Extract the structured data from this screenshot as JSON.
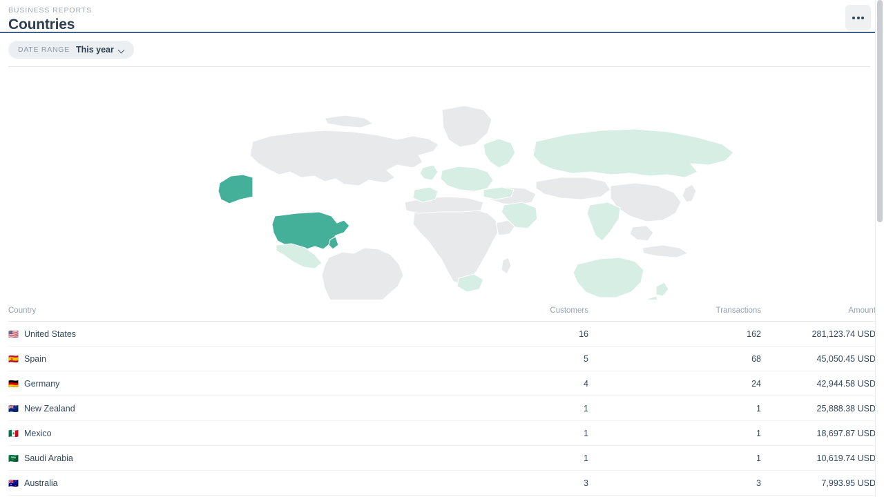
{
  "header": {
    "eyebrow": "BUSINESS REPORTS",
    "title": "Countries",
    "overflow_label": "•••"
  },
  "filter": {
    "label": "DATE RANGE",
    "value": "This year",
    "chevron_icon": "chevron-down-icon"
  },
  "colors": {
    "accent_strong": "#45b09a",
    "accent_light": "#d6eee4",
    "land_neutral": "#e7e9ea",
    "rule_dark": "#3f6185",
    "text_dark": "#33475b",
    "text_muted": "#93a1af",
    "pill_bg": "#eceff1",
    "button_bg": "#eef0f2"
  },
  "map": {
    "type": "choropleth",
    "regions": [
      {
        "name": "United States",
        "level": "strong"
      },
      {
        "name": "Alaska",
        "level": "strong"
      },
      {
        "name": "Mexico",
        "level": "light"
      },
      {
        "name": "Europe",
        "level": "light"
      },
      {
        "name": "Russia",
        "level": "light"
      },
      {
        "name": "Saudi Arabia",
        "level": "light"
      },
      {
        "name": "India",
        "level": "light"
      },
      {
        "name": "Australia",
        "level": "light"
      },
      {
        "name": "New Zealand",
        "level": "light"
      },
      {
        "name": "South Africa",
        "level": "light"
      },
      {
        "name": "Canada",
        "level": "neutral"
      },
      {
        "name": "South America",
        "level": "neutral"
      },
      {
        "name": "Africa",
        "level": "neutral"
      },
      {
        "name": "China",
        "level": "neutral"
      }
    ]
  },
  "table": {
    "columns": [
      "Country",
      "Customers",
      "Transactions",
      "Amount"
    ],
    "rows": [
      {
        "flag": "🇺🇸",
        "country": "United States",
        "customers": "16",
        "transactions": "162",
        "amount": "281,123.74 USD"
      },
      {
        "flag": "🇪🇸",
        "country": "Spain",
        "customers": "5",
        "transactions": "68",
        "amount": "45,050.45 USD"
      },
      {
        "flag": "🇩🇪",
        "country": "Germany",
        "customers": "4",
        "transactions": "24",
        "amount": "42,944.58 USD"
      },
      {
        "flag": "🇳🇿",
        "country": "New Zealand",
        "customers": "1",
        "transactions": "1",
        "amount": "25,888.38 USD"
      },
      {
        "flag": "🇲🇽",
        "country": "Mexico",
        "customers": "1",
        "transactions": "1",
        "amount": "18,697.87 USD"
      },
      {
        "flag": "🇸🇦",
        "country": "Saudi Arabia",
        "customers": "1",
        "transactions": "1",
        "amount": "10,619.74 USD"
      },
      {
        "flag": "🇦🇺",
        "country": "Australia",
        "customers": "3",
        "transactions": "3",
        "amount": "7,993.95 USD"
      }
    ]
  },
  "scrollbar": {
    "name": "vertical-scrollbar"
  }
}
